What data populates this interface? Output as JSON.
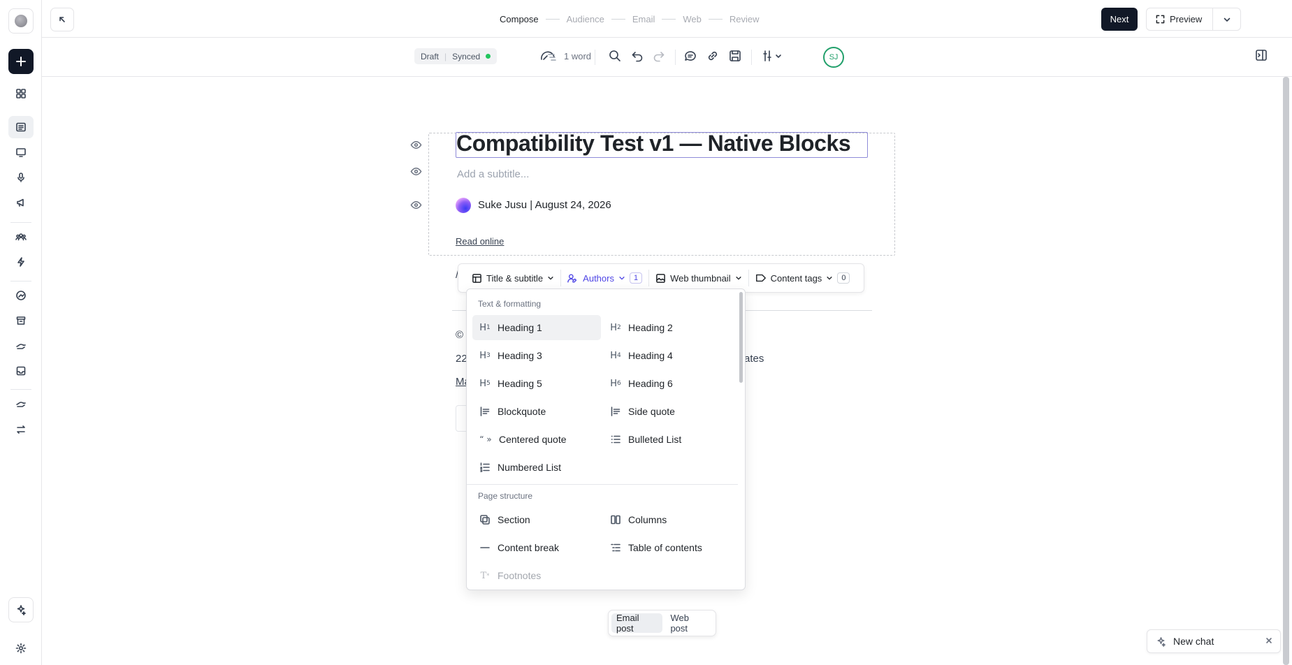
{
  "topbar": {
    "steps": [
      {
        "label": "Compose",
        "active": true
      },
      {
        "label": "Audience",
        "active": false
      },
      {
        "label": "Email",
        "active": false
      },
      {
        "label": "Web",
        "active": false
      },
      {
        "label": "Review",
        "active": false
      }
    ],
    "next_label": "Next",
    "preview_label": "Preview"
  },
  "toolbar": {
    "status_draft": "Draft",
    "status_synced": "Synced",
    "word_count": "1 word",
    "avatar_initials": "SJ"
  },
  "editor": {
    "title": "Compatibility Test v1 — Native Blocks",
    "subtitle_placeholder": "Add a subtitle...",
    "byline": "Suke Jusu | August 24, 2026",
    "read_online": "Read online",
    "behind_slash": "/",
    "behind_copyright": "©",
    "behind_address_prefix": "22",
    "behind_address_suffix": "ates",
    "behind_link": "Ma"
  },
  "meta_toolbar": {
    "title_subtitle": "Title & subtitle",
    "authors": "Authors",
    "authors_count": "1",
    "web_thumbnail": "Web thumbnail",
    "content_tags": "Content tags",
    "tags_count": "0"
  },
  "dropdown": {
    "section_text": "Text & formatting",
    "section_page": "Page structure",
    "items": [
      {
        "label": "Heading 1",
        "icon": "heading-1-icon"
      },
      {
        "label": "Heading 2",
        "icon": "heading-2-icon"
      },
      {
        "label": "Heading 3",
        "icon": "heading-3-icon"
      },
      {
        "label": "Heading 4",
        "icon": "heading-4-icon"
      },
      {
        "label": "Heading 5",
        "icon": "heading-5-icon"
      },
      {
        "label": "Heading 6",
        "icon": "heading-6-icon"
      },
      {
        "label": "Blockquote",
        "icon": "blockquote-icon"
      },
      {
        "label": "Side quote",
        "icon": "side-quote-icon"
      },
      {
        "label": "Centered quote",
        "icon": "centered-quote-icon"
      },
      {
        "label": "Bulleted List",
        "icon": "bulleted-list-icon"
      },
      {
        "label": "Numbered List",
        "icon": "numbered-list-icon"
      },
      {
        "label": "Section",
        "icon": "section-icon"
      },
      {
        "label": "Columns",
        "icon": "columns-icon"
      },
      {
        "label": "Content break",
        "icon": "content-break-icon"
      },
      {
        "label": "Table of contents",
        "icon": "table-of-contents-icon"
      },
      {
        "label": "Footnotes",
        "icon": "footnotes-icon"
      }
    ]
  },
  "post_toggle": {
    "email": "Email post",
    "web": "Web post",
    "selected": "Email post"
  },
  "new_chat": "New chat",
  "colors": {
    "primary_dark": "#111827",
    "accent": "#4f46e5",
    "synced_green": "#22c55e",
    "avatar_green": "#22a06b"
  }
}
